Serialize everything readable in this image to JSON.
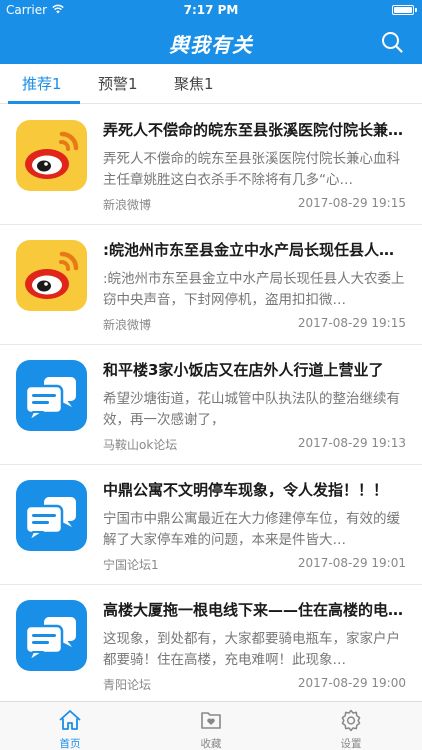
{
  "status_bar": {
    "carrier": "Carrier",
    "time": "7:17 PM"
  },
  "nav": {
    "title": "舆我有关",
    "search_icon": "search-icon"
  },
  "tabs": [
    {
      "label": "推荐1",
      "active": true
    },
    {
      "label": "预警1",
      "active": false
    },
    {
      "label": "聚焦1",
      "active": false
    }
  ],
  "articles": [
    {
      "icon": "weibo-icon",
      "title": "弄死人不偿命的皖东至县张溪医院付院长兼心血科主任章姚胜这白衣杀手",
      "summary": "弄死人不偿命的皖东至县张溪医院付院长兼心血科主任章姚胜这白衣杀手不除将有几多“心…",
      "source": "新浪微博",
      "date": "2017-08-29 19:15"
    },
    {
      "icon": "weibo-icon",
      "title": ":皖池州市东至县金立中水产局长现任县人大农委上窃中央声音",
      "summary": ":皖池州市东至县金立中水产局长现任县人大农委上窃中央声音，下封网停机，盗用扣扣微…",
      "source": "新浪微博",
      "date": "2017-08-29 19:15"
    },
    {
      "icon": "forum-chat-icon",
      "title": "和平楼3家小饭店又在店外人行道上营业了",
      "summary": "希望沙塘街道，花山城管中队执法队的整治继续有效，再一次感谢了，",
      "source": "马鞍山ok论坛",
      "date": "2017-08-29 19:13"
    },
    {
      "icon": "forum-chat-icon",
      "title": "中鼎公寓不文明停车现象，令人发指！！！",
      "summary": "宁国市中鼎公寓最近在大力修建停车位，有效的缓解了大家停车难的问题，本来是件皆大…",
      "source": "宁国论坛1",
      "date": "2017-08-29 19:01"
    },
    {
      "icon": "forum-chat-icon",
      "title": "高楼大厦拖一根电线下来——住在高楼的电瓶车",
      "summary": "这现象，到处都有，大家都要骑电瓶车，家家户户都要骑！住在高楼，充电难啊！此现象…",
      "source": "青阳论坛",
      "date": "2017-08-29 19:00"
    }
  ],
  "tabbar": [
    {
      "label": "首页",
      "icon": "home-icon",
      "active": true
    },
    {
      "label": "收藏",
      "icon": "favorites-icon",
      "active": false
    },
    {
      "label": "设置",
      "icon": "settings-gear-icon",
      "active": false
    }
  ],
  "colors": {
    "primary": "#1a8fe8",
    "weibo_bg": "#f8c93a",
    "weibo_red": "#e0261a",
    "forum_bg": "#1a8fe8"
  }
}
